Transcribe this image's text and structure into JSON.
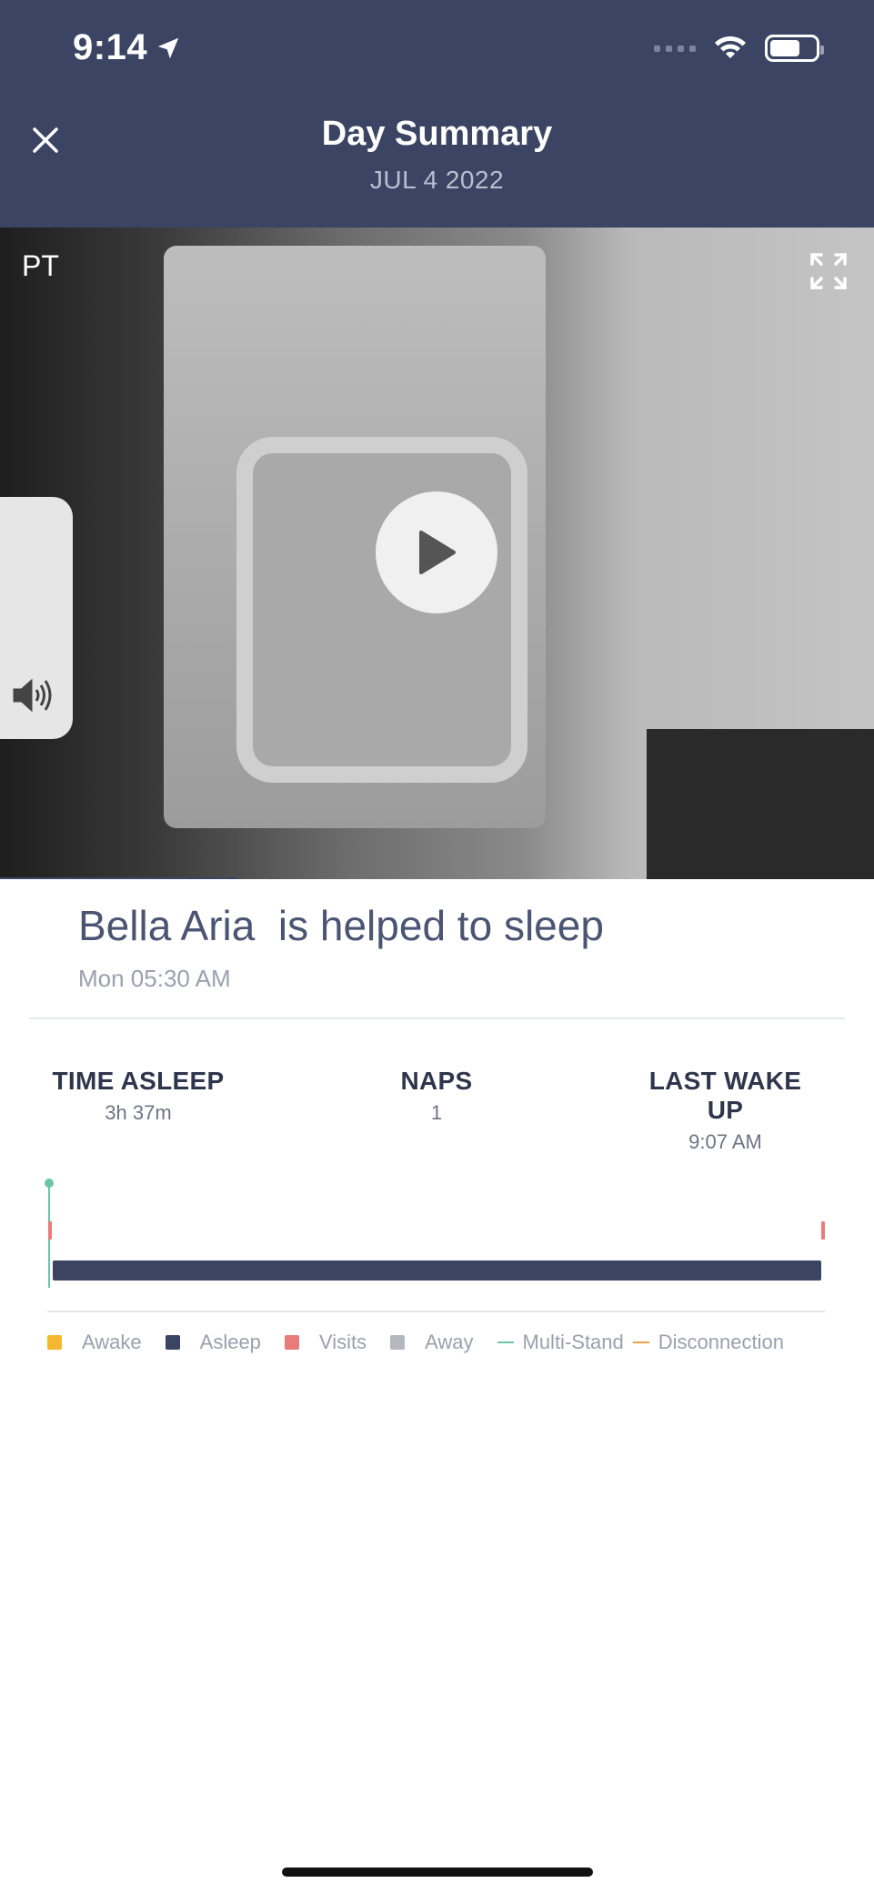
{
  "status_bar": {
    "time": "9:14"
  },
  "header": {
    "title": "Day Summary",
    "date": "JUL 4 2022"
  },
  "video": {
    "camera_label": "PT"
  },
  "event": {
    "title": "Bella Aria  is helped to sleep",
    "time": "Mon 05:30 AM"
  },
  "stats": [
    {
      "label": "TIME ASLEEP",
      "value": "3h 37m"
    },
    {
      "label": "NAPS",
      "value": "1"
    },
    {
      "label": "LAST WAKE UP",
      "value": "9:07 AM"
    }
  ],
  "legend": [
    {
      "label": "Awake",
      "color": "#f5b731",
      "kind": "box"
    },
    {
      "label": "Asleep",
      "color": "#3b4563",
      "kind": "box"
    },
    {
      "label": "Visits",
      "color": "#ea7b7b",
      "kind": "box"
    },
    {
      "label": "Away",
      "color": "#b5b8be",
      "kind": "box"
    },
    {
      "label": "Multi-Stand",
      "color": "#6cc3a6",
      "kind": "line"
    },
    {
      "label": "Disconnection",
      "color": "#f2a04a",
      "kind": "line"
    }
  ],
  "timeline": {
    "asleep_start_fraction": 0.0,
    "asleep_end_fraction": 1.0,
    "multistand_marker_fraction": 0.0,
    "visit_marks": [
      0.0,
      1.0
    ]
  }
}
